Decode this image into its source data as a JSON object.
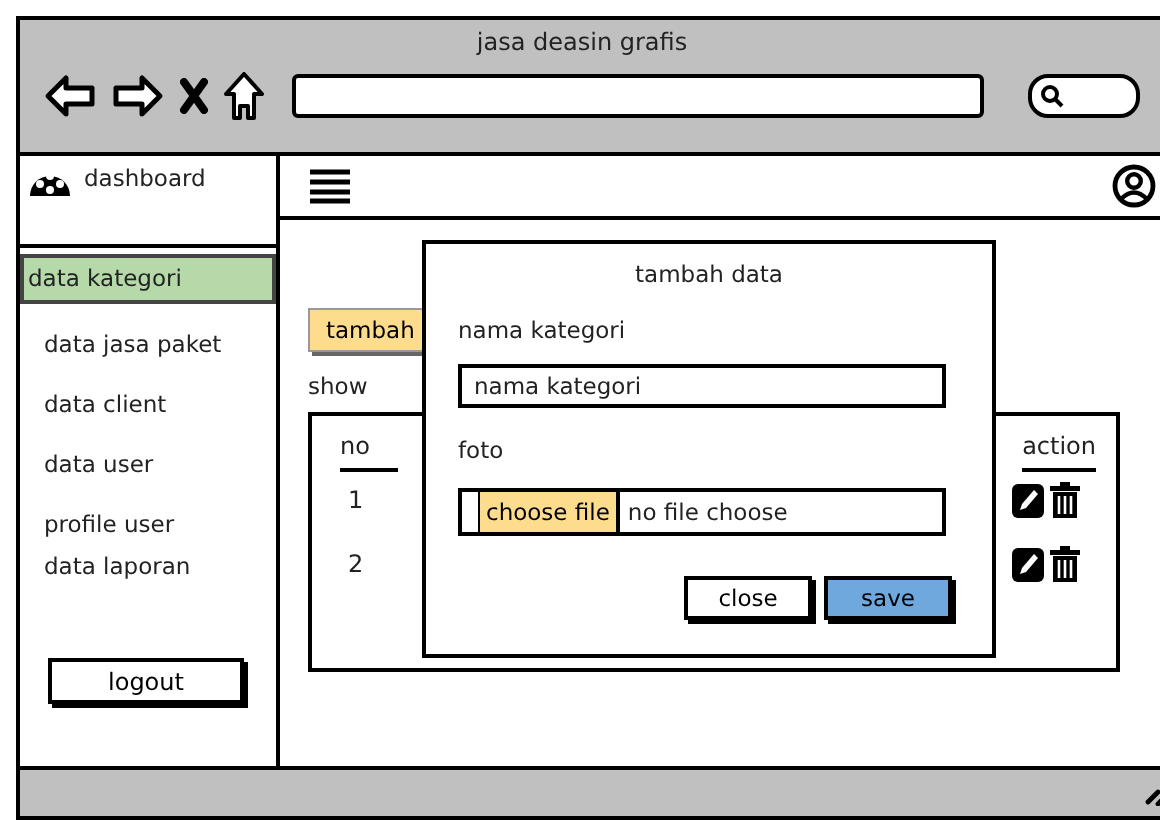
{
  "window": {
    "title": "jasa deasin grafis"
  },
  "sidebar": {
    "header": "dashboard",
    "items": [
      {
        "label": "data kategori",
        "selected": true
      },
      {
        "label": "data jasa paket",
        "selected": false
      },
      {
        "label": "data client",
        "selected": false
      },
      {
        "label": "data user",
        "selected": false
      },
      {
        "label": "profile user",
        "selected": false
      },
      {
        "label": "data laporan",
        "selected": false
      }
    ],
    "logout": "logout"
  },
  "content": {
    "add_button": "tambah",
    "show_label": "show",
    "table": {
      "columns": [
        "no",
        "action"
      ],
      "rows": [
        {
          "no": "1"
        },
        {
          "no": "2"
        }
      ]
    }
  },
  "modal": {
    "title": "tambah data",
    "name_label": "nama kategori",
    "name_value": "nama kategori",
    "photo_label": "foto",
    "choose_button": "choose file",
    "file_status": "no file choose",
    "buttons": [
      {
        "label": "close",
        "kind": "secondary"
      },
      {
        "label": "save",
        "kind": "primary"
      }
    ]
  }
}
